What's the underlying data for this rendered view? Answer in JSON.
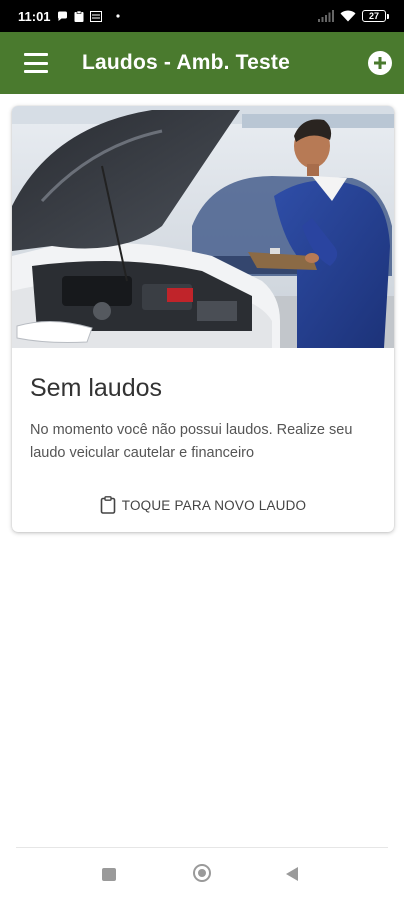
{
  "status_bar": {
    "time": "11:01",
    "battery": "27",
    "icons": [
      "chat-bubble-icon",
      "clipboard-icon",
      "sim-icon",
      "dot-icon",
      "signal-icon",
      "wifi-icon",
      "battery-icon"
    ]
  },
  "app_bar": {
    "title": "Laudos - Amb. Teste",
    "menu_icon": "hamburger-menu-icon",
    "add_icon": "add-circle-icon",
    "color": "#4a7a2e"
  },
  "card": {
    "image_subject": "mechanic-with-car-hood-open",
    "title": "Sem laudos",
    "body": "No momento você não possui laudos. Realize seu laudo veicular cautelar e financeiro",
    "action_label": "TOQUE PARA NOVO LAUDO",
    "action_icon": "clipboard-icon"
  },
  "nav_bar": {
    "icons": [
      "recent-apps-icon",
      "home-icon",
      "back-icon"
    ]
  }
}
